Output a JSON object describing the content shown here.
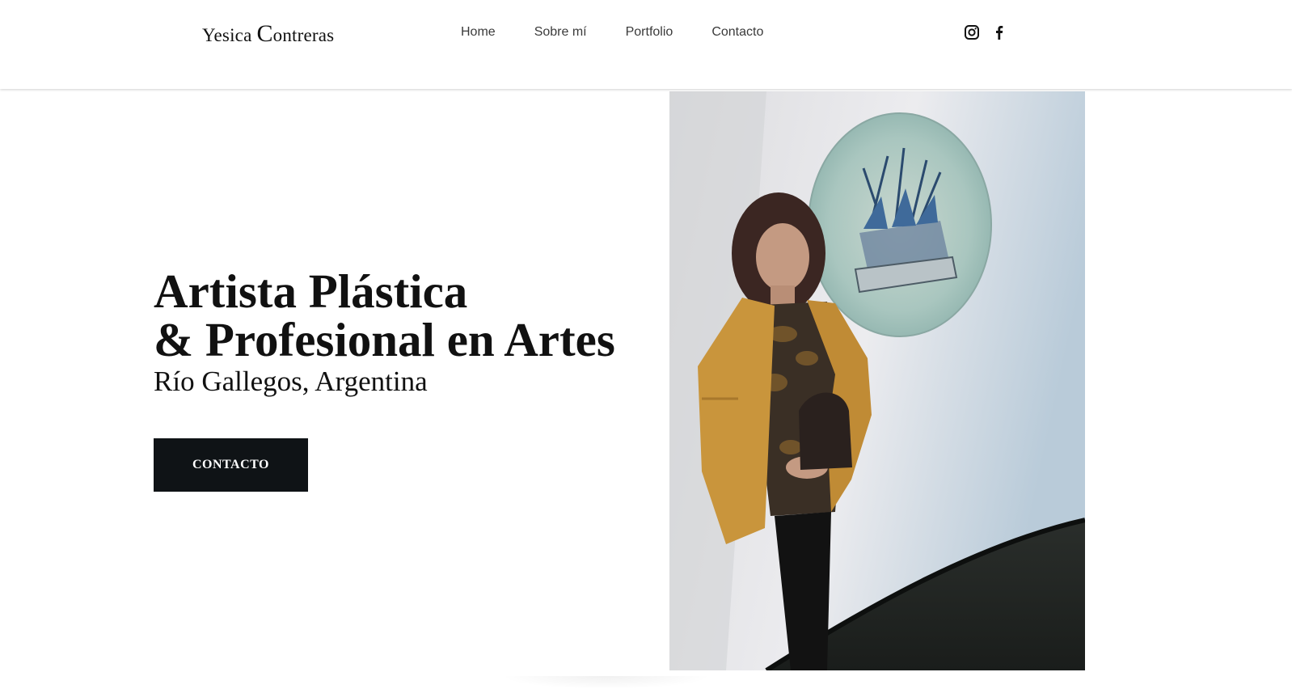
{
  "header": {
    "logo_first": "Yesica ",
    "logo_cap": "C",
    "logo_rest": "ontreras",
    "nav": [
      {
        "label": "Home"
      },
      {
        "label": "Sobre mí"
      },
      {
        "label": "Portfolio"
      },
      {
        "label": "Contacto"
      }
    ],
    "social_icons": [
      "instagram-icon",
      "facebook-icon"
    ]
  },
  "hero": {
    "title_line1": "Artista Plástica",
    "title_line2": "& Profesional en Artes",
    "subtitle": "Río Gallegos, Argentina",
    "cta_label": "CONTACTO"
  },
  "colors": {
    "text": "#111111",
    "nav_text": "#3a3a3a",
    "button_bg": "#0f1316",
    "button_text": "#ffffff",
    "background": "#ffffff"
  }
}
